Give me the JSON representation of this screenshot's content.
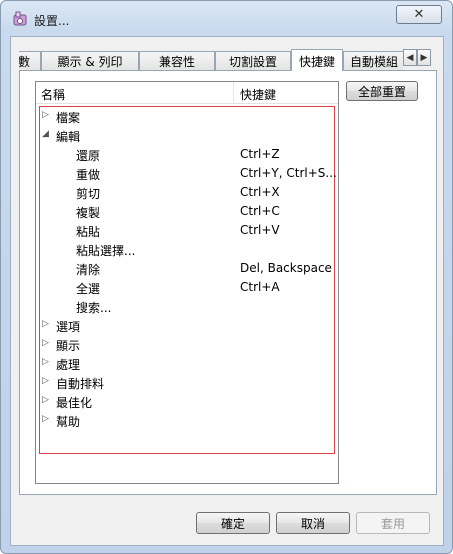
{
  "window": {
    "title": "設置...",
    "close_glyph": "✕"
  },
  "tabs": [
    {
      "label": "數",
      "active": false
    },
    {
      "label": "顯示 & 列印",
      "active": false
    },
    {
      "label": "兼容性",
      "active": false
    },
    {
      "label": "切割設置",
      "active": false
    },
    {
      "label": "快捷鍵",
      "active": true
    },
    {
      "label": "自動模組",
      "active": false
    }
  ],
  "tab_scroll": {
    "left": "◀",
    "right": "▶"
  },
  "list": {
    "columns": {
      "name": "名稱",
      "shortcut": "快捷鍵"
    },
    "rows": [
      {
        "label": "檔案",
        "level": 0,
        "expanded": false,
        "shortcut": ""
      },
      {
        "label": "編輯",
        "level": 0,
        "expanded": true,
        "shortcut": ""
      },
      {
        "label": "還原",
        "level": 1,
        "shortcut": "Ctrl+Z"
      },
      {
        "label": "重做",
        "level": 1,
        "shortcut": "Ctrl+Y, Ctrl+S..."
      },
      {
        "label": "剪切",
        "level": 1,
        "shortcut": "Ctrl+X"
      },
      {
        "label": "複製",
        "level": 1,
        "shortcut": "Ctrl+C"
      },
      {
        "label": "粘貼",
        "level": 1,
        "shortcut": "Ctrl+V"
      },
      {
        "label": "粘貼選擇...",
        "level": 1,
        "shortcut": ""
      },
      {
        "label": "清除",
        "level": 1,
        "shortcut": "Del, Backspace"
      },
      {
        "label": "全選",
        "level": 1,
        "shortcut": "Ctrl+A"
      },
      {
        "label": "搜索...",
        "level": 1,
        "shortcut": ""
      },
      {
        "label": "選項",
        "level": 0,
        "expanded": false,
        "shortcut": ""
      },
      {
        "label": "顯示",
        "level": 0,
        "expanded": false,
        "shortcut": ""
      },
      {
        "label": "處理",
        "level": 0,
        "expanded": false,
        "shortcut": ""
      },
      {
        "label": "自動排料",
        "level": 0,
        "expanded": false,
        "shortcut": ""
      },
      {
        "label": "最佳化",
        "level": 0,
        "expanded": false,
        "shortcut": ""
      },
      {
        "label": "幫助",
        "level": 0,
        "expanded": false,
        "shortcut": ""
      }
    ]
  },
  "buttons": {
    "reset_all": "全部重置",
    "ok": "確定",
    "cancel": "取消",
    "apply": "套用"
  },
  "colors": {
    "highlight_border": "#e0404a"
  },
  "icons": {
    "app": "settings-app-icon",
    "collapsed": "triangle-right-icon",
    "expanded": "triangle-down-icon"
  }
}
